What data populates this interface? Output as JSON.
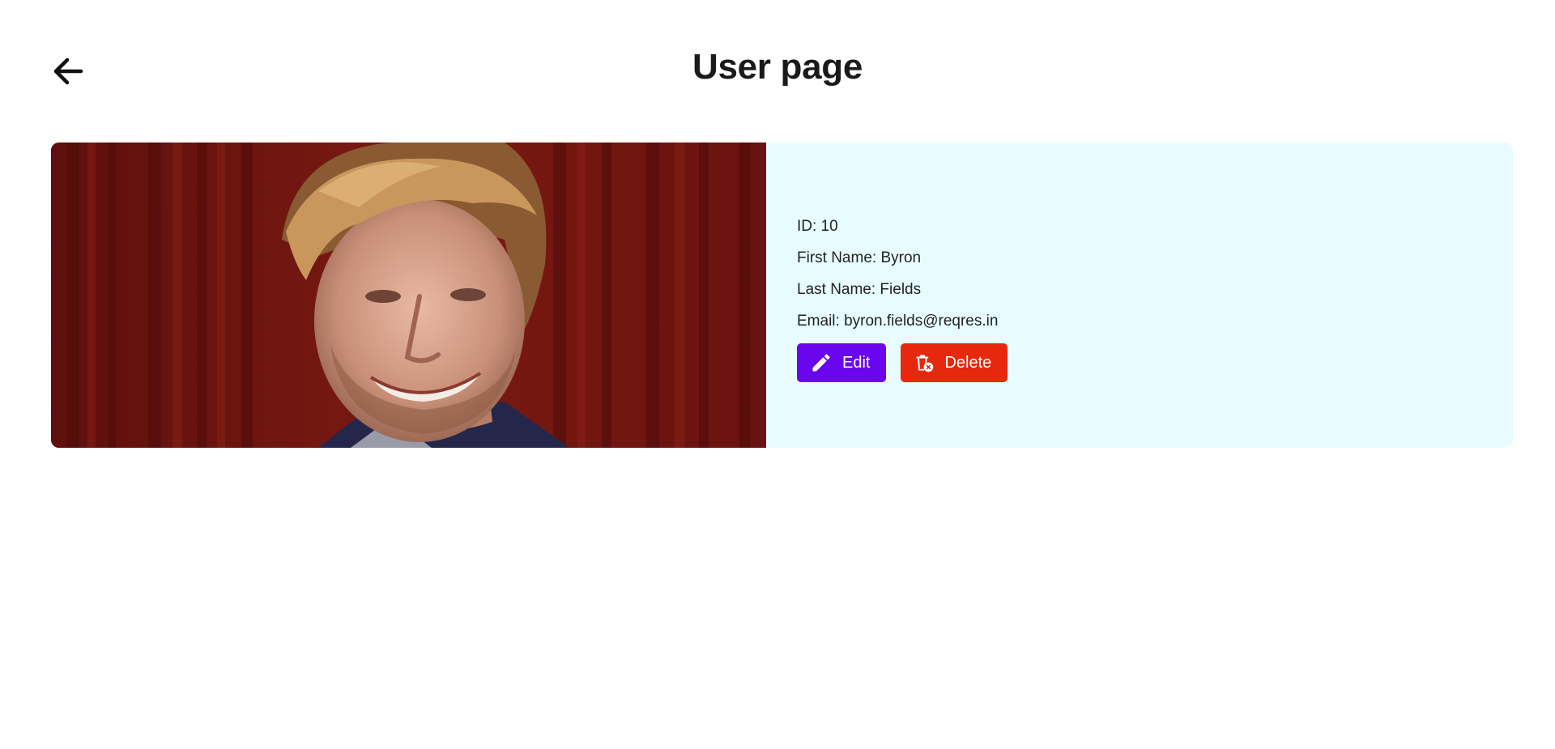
{
  "header": {
    "title": "User page",
    "back_icon": "arrow-left-icon"
  },
  "user": {
    "id_line": "ID: 10",
    "first_name_line": "First Name: Byron",
    "last_name_line": "Last Name: Fields",
    "email_line": "Email: byron.fields@reqres.in"
  },
  "actions": {
    "edit_label": "Edit",
    "edit_icon": "pencil-icon",
    "delete_label": "Delete",
    "delete_icon": "trash-x-icon"
  },
  "colors": {
    "edit_button": "#6a06ee",
    "delete_button": "#e6280d",
    "card_background": "#e8fcff"
  }
}
